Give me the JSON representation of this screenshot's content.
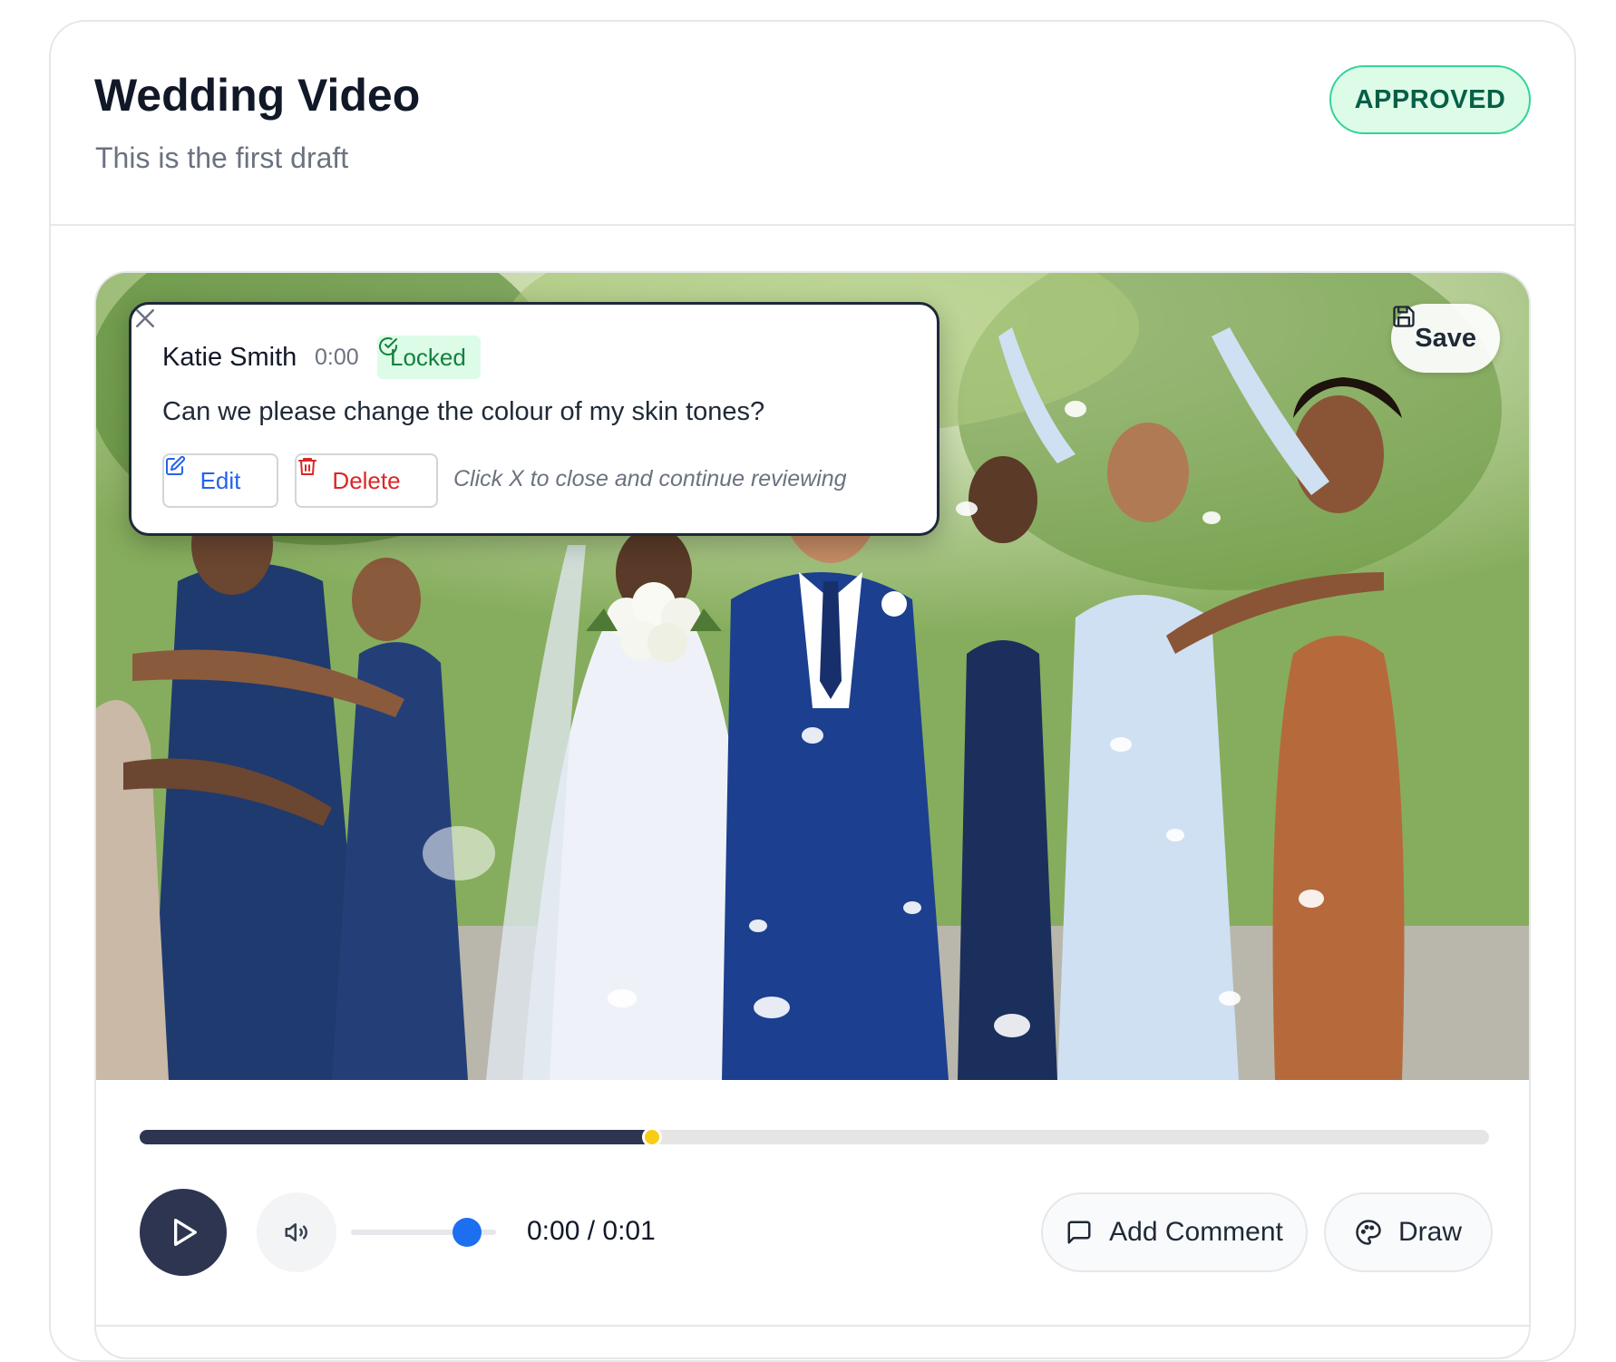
{
  "project": {
    "title": "Wedding Video",
    "subtitle": "This is the first draft",
    "status": "APPROVED"
  },
  "video": {
    "save_label": "Save"
  },
  "comment": {
    "author": "Katie Smith",
    "timestamp": "0:00",
    "badge": "Locked",
    "text": "Can we please change the colour of my skin tones?",
    "edit_label": "Edit",
    "delete_label": "Delete",
    "hint": "Click X to close and continue reviewing"
  },
  "controls": {
    "progress_fraction": 0.38,
    "volume_fraction": 0.8,
    "timecode": "0:00 / 0:01",
    "add_comment_label": "Add Comment",
    "draw_label": "Draw"
  },
  "colors": {
    "approved_bg": "#dcfce7",
    "approved_border": "#34d399",
    "approved_text": "#065f46",
    "progress_fill": "#2d3550",
    "progress_marker": "#facc15",
    "volume_thumb": "#1d6ff2",
    "edit_blue": "#2563eb",
    "delete_red": "#dc2626",
    "locked_green": "#15803d"
  },
  "icons": {
    "save": "floppy-disk-icon",
    "locked": "check-circle-icon",
    "close": "close-icon",
    "edit": "edit-icon",
    "delete": "trash-icon",
    "play": "play-icon",
    "volume": "volume-icon",
    "comment": "message-square-icon",
    "draw": "palette-icon"
  }
}
